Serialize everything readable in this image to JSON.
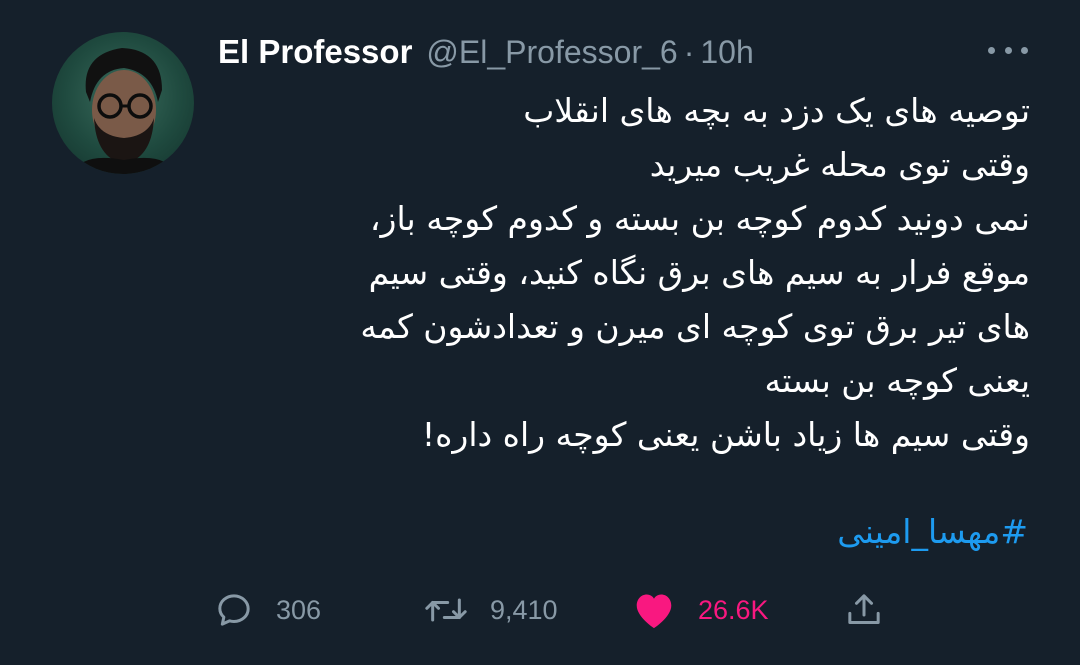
{
  "tweet": {
    "display_name": "El Professor",
    "handle": "@El_Professor_6",
    "separator": "·",
    "time": "10h",
    "lines": [
      "توصیه های یک دزد به بچه های انقلاب",
      "وقتی توی محله غریب میرید",
      "نمی دونید کدوم کوچه بن بسته و کدوم کوچه باز،",
      "موقع فرار به سیم های برق نگاه کنید، وقتی سیم",
      "های تیر برق توی کوچه ای میرن و تعدادشون کمه",
      "یعنی کوچه بن بسته",
      "وقتی سیم ها زیاد باشن یعنی کوچه راه داره!"
    ],
    "hashtag": "#مهسا_امینی"
  },
  "actions": {
    "replies": "306",
    "retweets": "9,410",
    "likes": "26.6K",
    "liked": true,
    "like_color": "#f91880"
  },
  "icons": {
    "more": "more-horizontal-icon",
    "reply": "reply-icon",
    "retweet": "retweet-icon",
    "like": "heart-icon",
    "share": "share-icon"
  },
  "colors": {
    "background": "#15202b",
    "text": "#ffffff",
    "secondary": "#8899a6",
    "link": "#1d9bf0"
  }
}
